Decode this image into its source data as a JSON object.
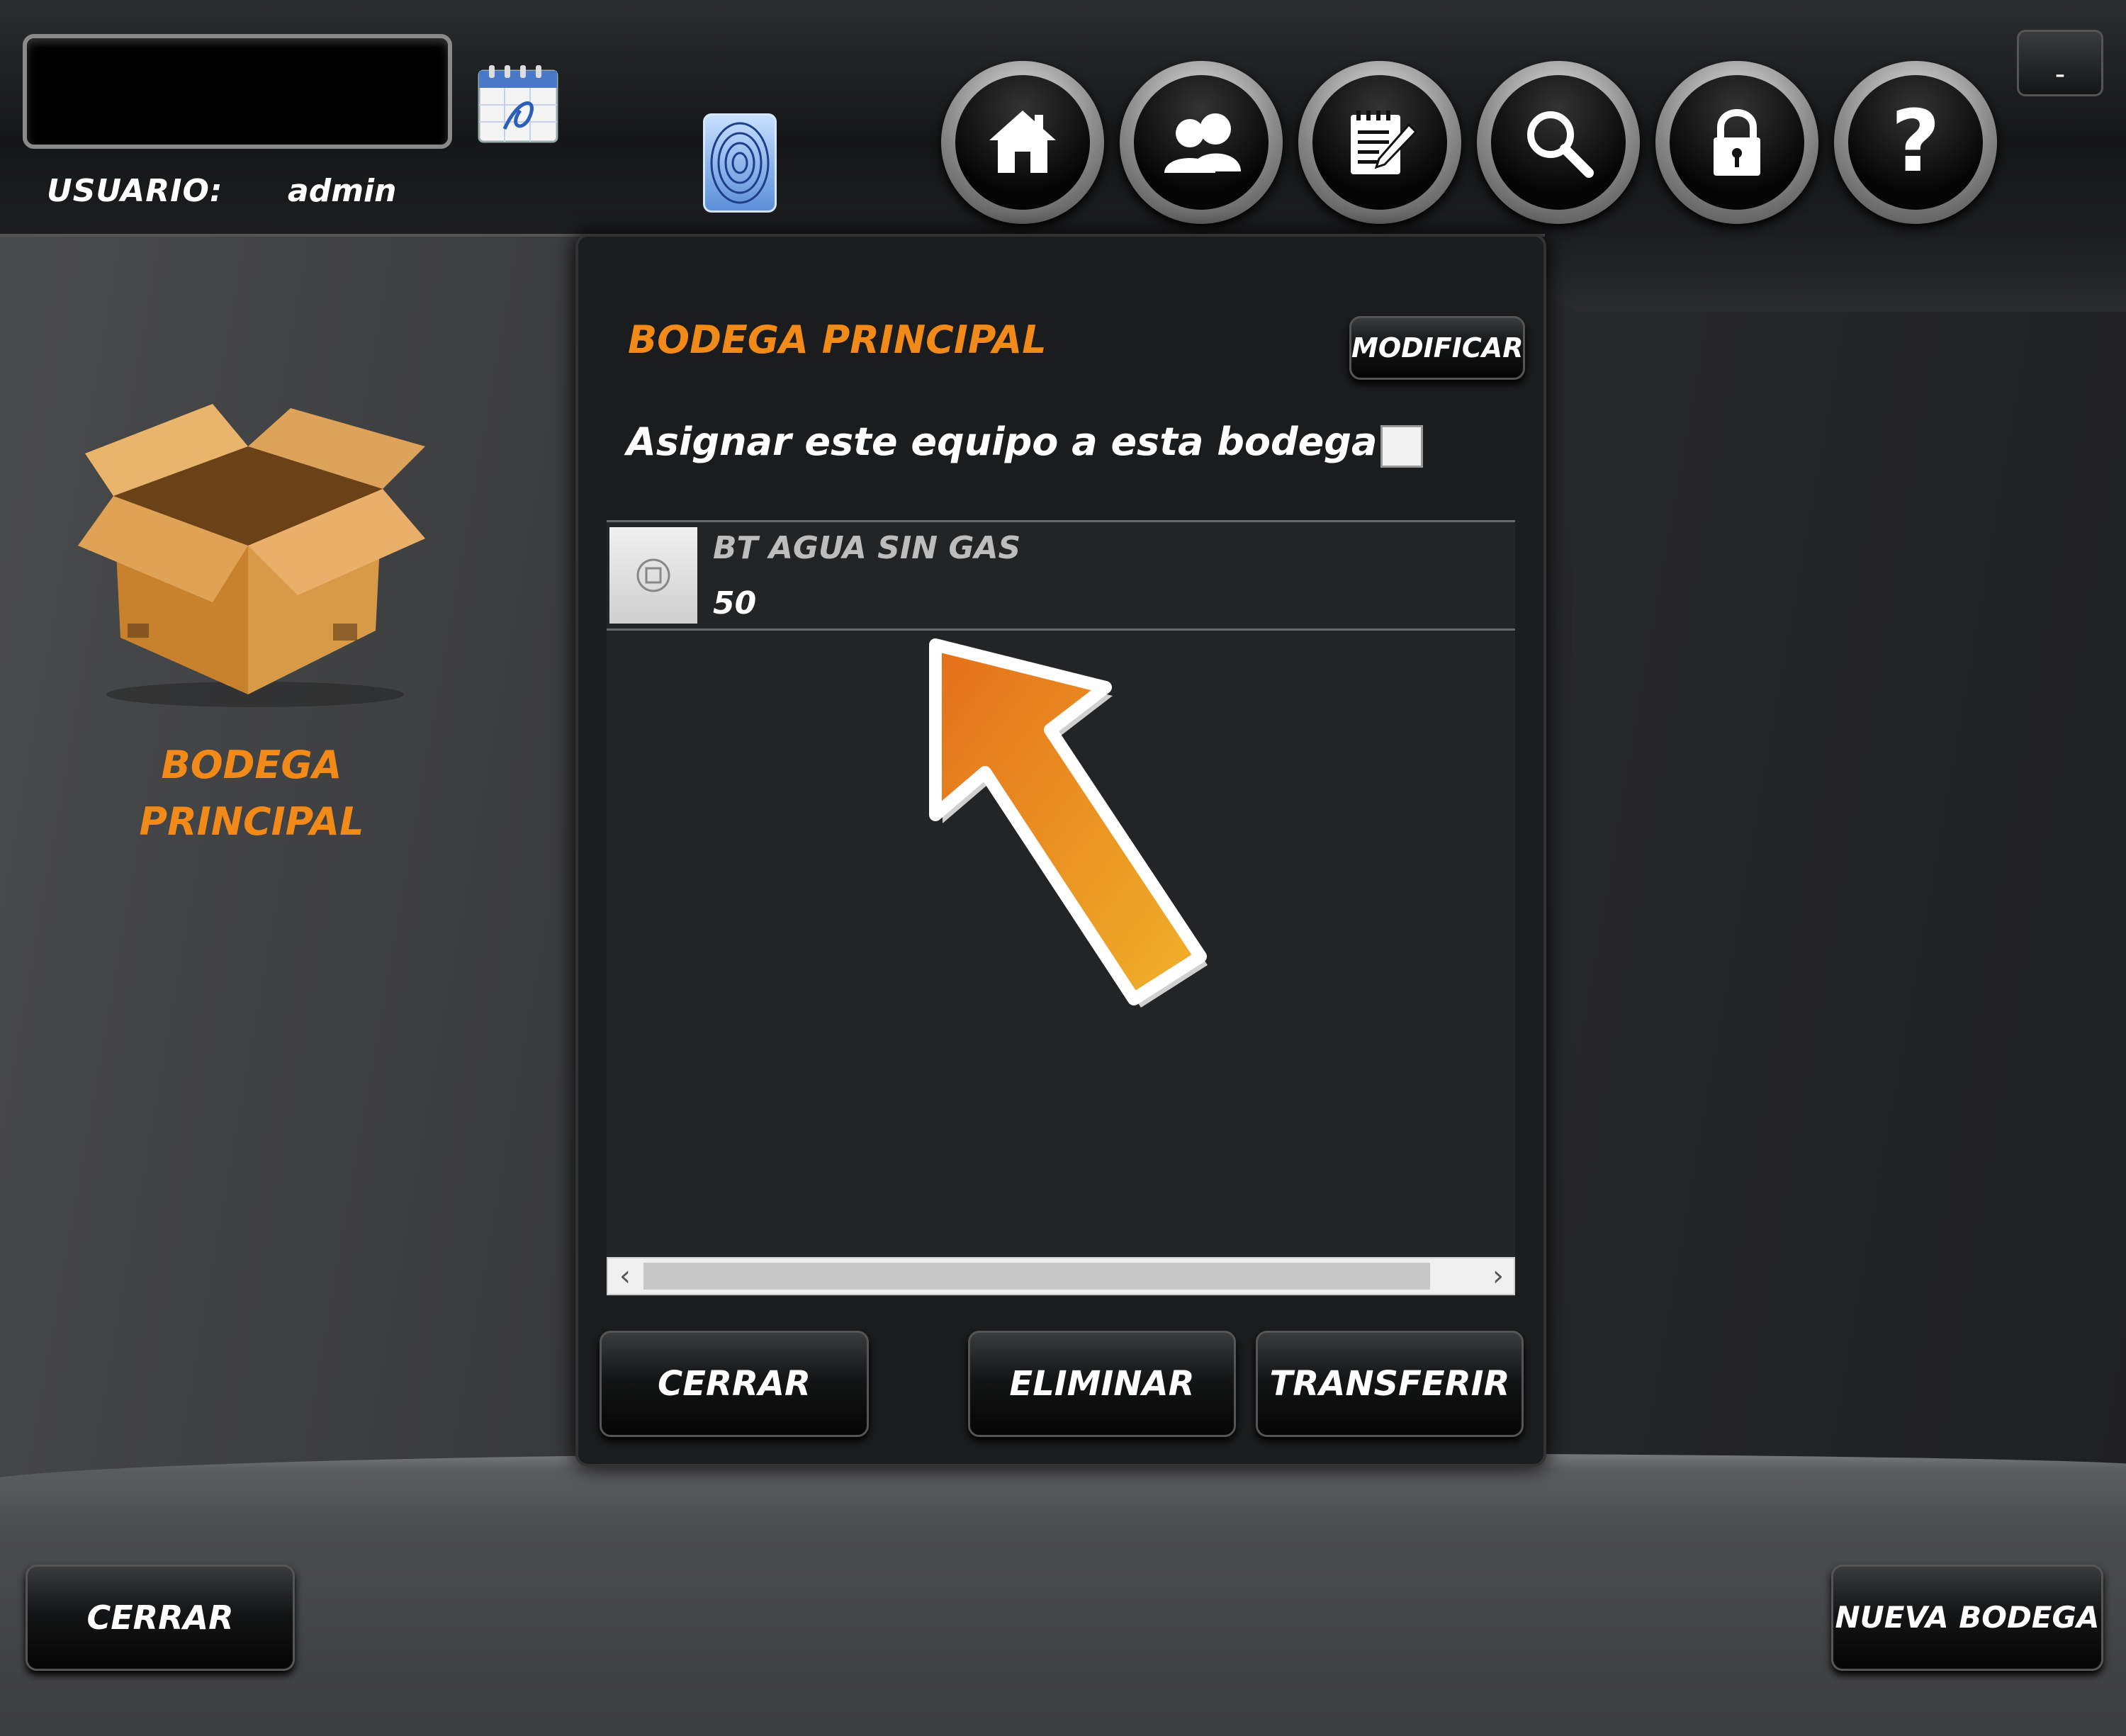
{
  "header": {
    "user_label": "USUARIO:",
    "user_value": "admin",
    "minimize_label": "-",
    "nav_icons": [
      "home-icon",
      "users-icon",
      "notepad-edit-icon",
      "search-icon",
      "lock-icon",
      "help-icon"
    ],
    "help_glyph": "?"
  },
  "sidebar": {
    "warehouse_icon": "box-icon",
    "warehouse_name_line1": "BODEGA",
    "warehouse_name_line2": "PRINCIPAL"
  },
  "dialog": {
    "title": "BODEGA PRINCIPAL",
    "modify_label": "MODIFICAR",
    "assign_label": "Asignar este equipo a esta bodega",
    "assign_checked": false,
    "products": [
      {
        "name": "BT AGUA SIN GAS",
        "quantity": "50"
      }
    ],
    "scroll_left": "‹",
    "scroll_right": "›",
    "close_label": "CERRAR",
    "delete_label": "ELIMINAR",
    "transfer_label": "TRANSFERIR"
  },
  "footer": {
    "close_label": "CERRAR",
    "new_warehouse_label": "NUEVA BODEGA"
  },
  "colors": {
    "accent_orange": "#f28a1a",
    "arrow_start": "#e46f1a",
    "arrow_end": "#f0b22a"
  }
}
